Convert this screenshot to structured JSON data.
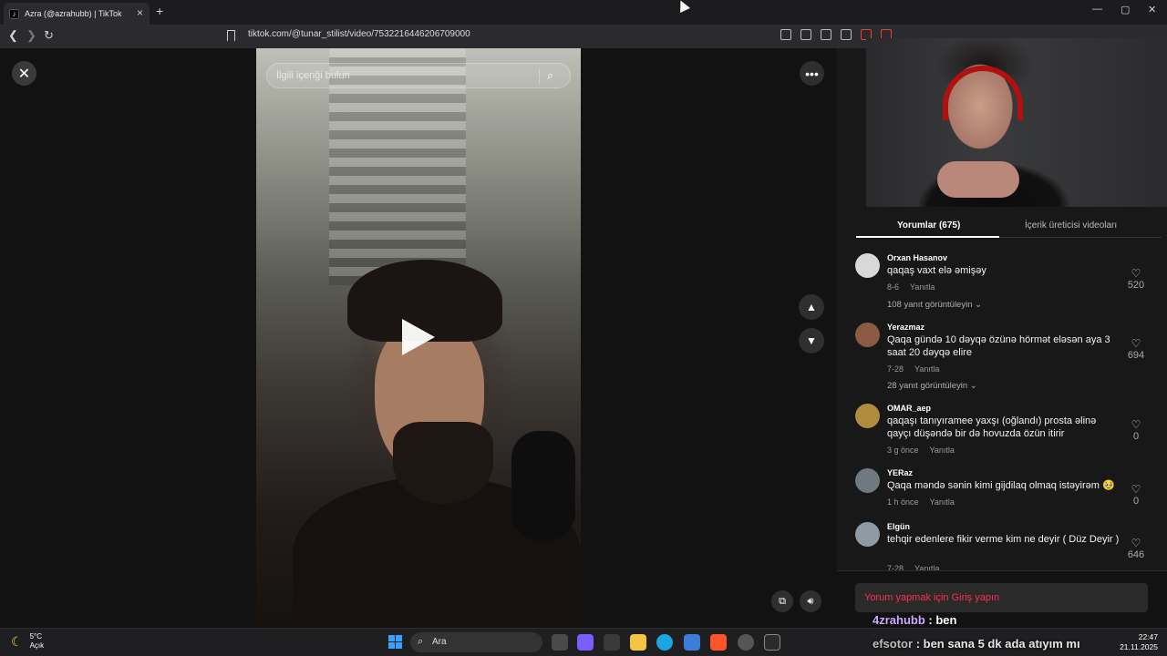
{
  "browser": {
    "tab_title": "Azra (@azrahubb) | TikTok",
    "tab_favicon": "tiktok-icon",
    "url": "tiktok.com/@tunar_stilist/video/7532216446206709000"
  },
  "video": {
    "search_placeholder": "İlgili içeriği bulun"
  },
  "panel": {
    "tabs": {
      "comments": "Yorumlar (675)",
      "creator_videos": "İçerik üreticisi videoları"
    },
    "reply_label": "Yanıtla",
    "comments": [
      {
        "user": "Orxan Hasanov",
        "text": "qaqaş vaxt elə əmişəy",
        "date": "8-6",
        "likes": "520",
        "more_replies": "108 yanıt görüntüleyin"
      },
      {
        "user": "Yerazmaz",
        "text": "Qaqa gündə 10 dəyqə özünə hörmət eləsən aya 3 saat 20 dəyqə elire",
        "date": "7-28",
        "likes": "694",
        "more_replies": "28 yanıt görüntüleyin"
      },
      {
        "user": "OMAR_aep",
        "text": "qaqaşı tanıyıramee yaxşı (oğlandı) prosta əlinə qayçı düşəndə bir də hovuzda özün itirir",
        "date": "3 g önce",
        "likes": "0"
      },
      {
        "user": "YERaz",
        "text": "Qaqa məndə sənin kimi gijdilaq olmaq istəyirəm 🥹",
        "date": "1 h önce",
        "likes": "0"
      },
      {
        "user": "Elgün",
        "text": "tehqir edenlere fikir verme kim ne deyir ( Düz Deyir )",
        "date": "7-28",
        "likes": "646"
      }
    ],
    "login_prompt": "Yorum yapmak için Giriş yapın"
  },
  "chat_overlay": [
    {
      "name": "4zrahubb",
      "message": ": ben"
    },
    {
      "name": "efsotor",
      "message": ": ben sana 5 dk ada atıyım mı"
    }
  ],
  "taskbar": {
    "temperature": "5°C",
    "weather": "Açık",
    "search_placeholder": "Ara",
    "time": "22:47",
    "date": "21.11.2025"
  }
}
